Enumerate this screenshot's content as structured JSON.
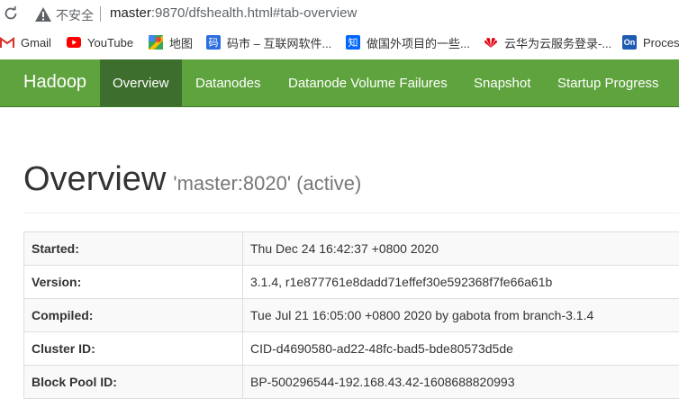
{
  "browser": {
    "security_label": "不安全",
    "url_host": "master",
    "url_rest": ":9870/dfshealth.html#tab-overview"
  },
  "bookmarks": [
    {
      "label": "Gmail",
      "icon": "gmail-icon"
    },
    {
      "label": "YouTube",
      "icon": "youtube-icon"
    },
    {
      "label": "地图",
      "icon": "maps-icon"
    },
    {
      "label": "码市 – 互联网软件...",
      "icon": "mashi-icon"
    },
    {
      "label": "做国外项目的一些...",
      "icon": "zhihu-icon"
    },
    {
      "label": "云华为云服务登录-...",
      "icon": "huawei-icon"
    },
    {
      "label": "Proces",
      "icon": "onenote-icon"
    }
  ],
  "navbar": {
    "brand": "Hadoop",
    "items": [
      {
        "label": "Overview",
        "active": true
      },
      {
        "label": "Datanodes",
        "active": false
      },
      {
        "label": "Datanode Volume Failures",
        "active": false
      },
      {
        "label": "Snapshot",
        "active": false
      },
      {
        "label": "Startup Progress",
        "active": false
      }
    ]
  },
  "page": {
    "title": "Overview",
    "subtitle": "'master:8020' (active)"
  },
  "overview_table": [
    {
      "key": "Started:",
      "value": "Thu Dec 24 16:42:37 +0800 2020"
    },
    {
      "key": "Version:",
      "value": "3.1.4, r1e877761e8dadd71effef30e592368f7fe66a61b"
    },
    {
      "key": "Compiled:",
      "value": "Tue Jul 21 16:05:00 +0800 2020 by gabota from branch-3.1.4"
    },
    {
      "key": "Cluster ID:",
      "value": "CID-d4690580-ad22-48fc-bad5-bde80573d5de"
    },
    {
      "key": "Block Pool ID:",
      "value": "BP-500296544-192.168.43.42-1608688820993"
    }
  ],
  "colors": {
    "navbar": "#5fa33e",
    "navbar_active": "#3d6e2d",
    "heading": "#333333",
    "subtitle": "#777777"
  }
}
